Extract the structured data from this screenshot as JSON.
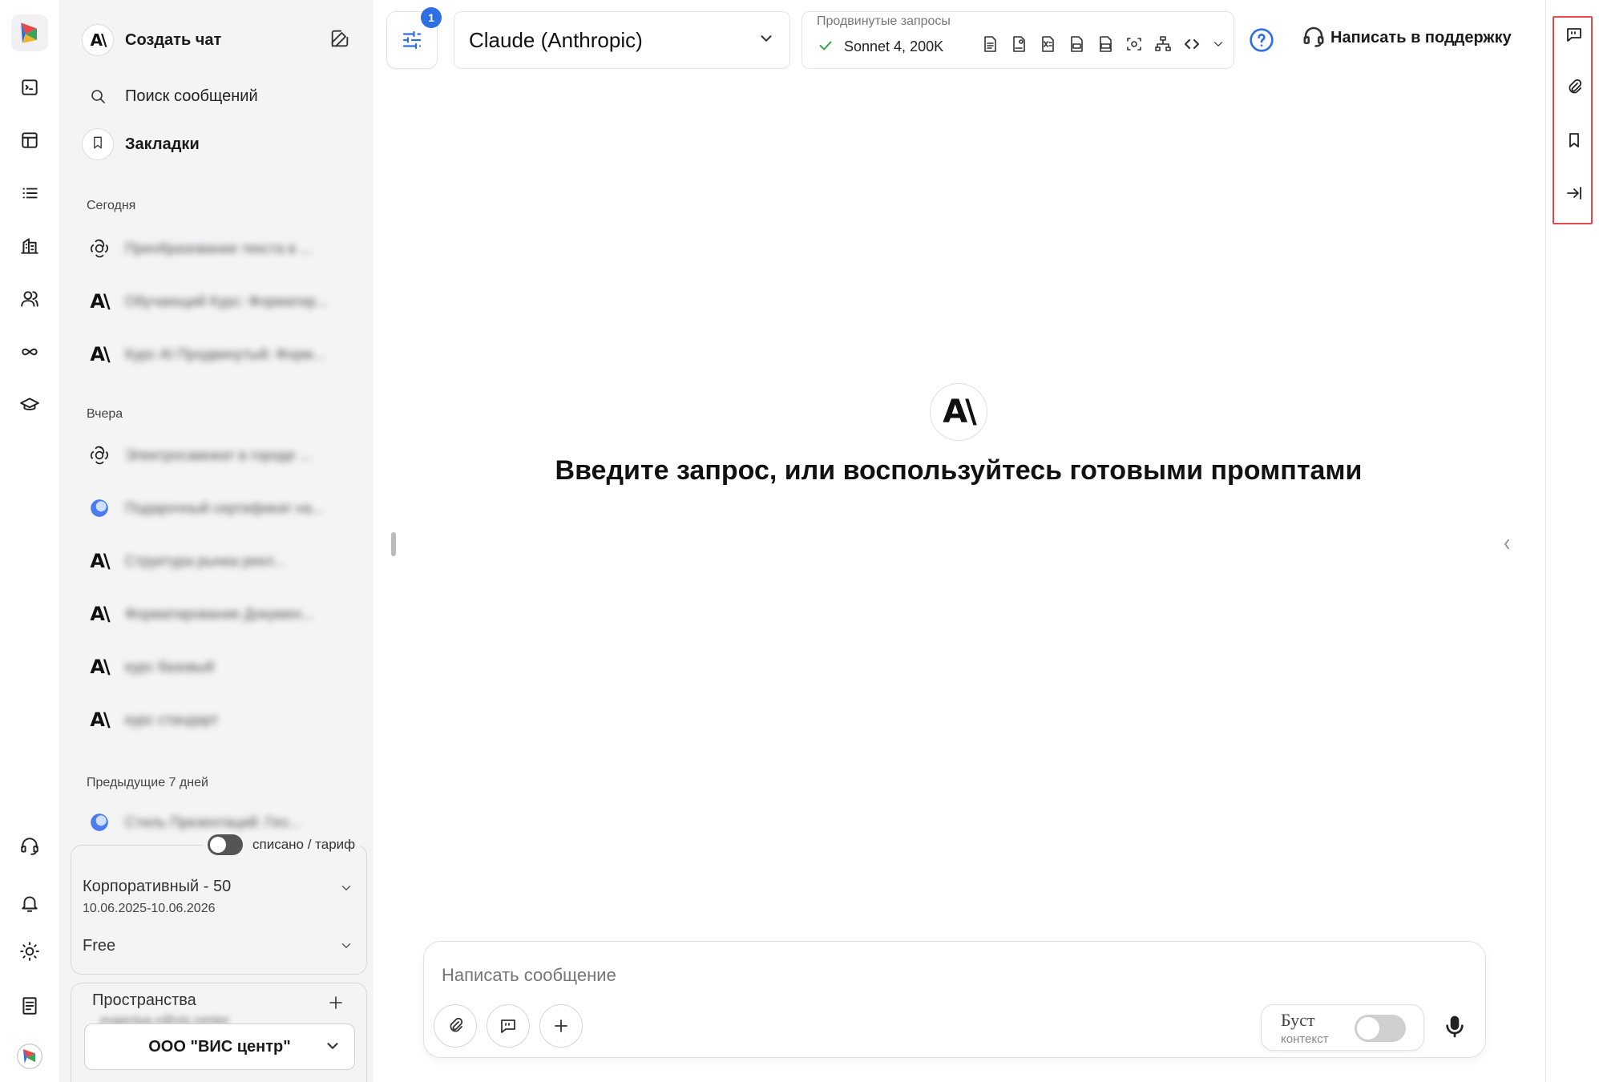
{
  "sidebar": {
    "create_chat": "Создать чат",
    "search": "Поиск сообщений",
    "bookmarks": "Закладки",
    "groups": {
      "today": "Сегодня",
      "yesterday": "Вчера",
      "prev7": "Предыдущие 7 дней"
    },
    "chats_today": [
      {
        "icon": "openai-icon",
        "title": "Преобразование текста в ..."
      },
      {
        "icon": "anthropic-icon",
        "title": "Обучающий Курс: Форматир..."
      },
      {
        "icon": "anthropic-icon",
        "title": "Курс AI Продвинутый: Форм..."
      }
    ],
    "chats_yesterday": [
      {
        "icon": "openai-icon",
        "title": "Электросамокат в городе ..."
      },
      {
        "icon": "gemini-icon",
        "title": "Подарочный сертификат на..."
      },
      {
        "icon": "anthropic-icon",
        "title": "Структура рынка рекл..."
      },
      {
        "icon": "anthropic-icon",
        "title": "Форматирование Докумен..."
      },
      {
        "icon": "anthropic-icon",
        "title": "курс базовый"
      },
      {
        "icon": "anthropic-icon",
        "title": "курс стандарт"
      }
    ],
    "chats_prev7": [
      {
        "icon": "gemini-icon",
        "title": "Стиль Презентаций: Гео..."
      }
    ],
    "tariff_toggle_label": "списано / тариф",
    "plan_name": "Корпоративный - 50",
    "plan_dates": "10.06.2025-10.06.2026",
    "plan_tier": "Free",
    "spaces_label": "Пространства",
    "spaces_user": "evgeniya.v@vis.center",
    "spaces_selected": "ООО \"ВИС центр\""
  },
  "topbar": {
    "settings_badge": "1",
    "model_name": "Claude (Anthropic)",
    "advanced_label": "Продвинутые запросы",
    "advanced_model": "Sonnet 4, 200K",
    "support_label": "Написать в поддержку"
  },
  "main": {
    "welcome": "Введите запрос, или воспользуйтесь готовыми промптами",
    "composer_placeholder": "Написать сообщение",
    "boost_label": "Буст",
    "boost_sub": "контекст"
  },
  "colors": {
    "accent_blue": "#2f6fe4",
    "highlight_red": "#e5484d",
    "check_green": "#3aa35a"
  }
}
